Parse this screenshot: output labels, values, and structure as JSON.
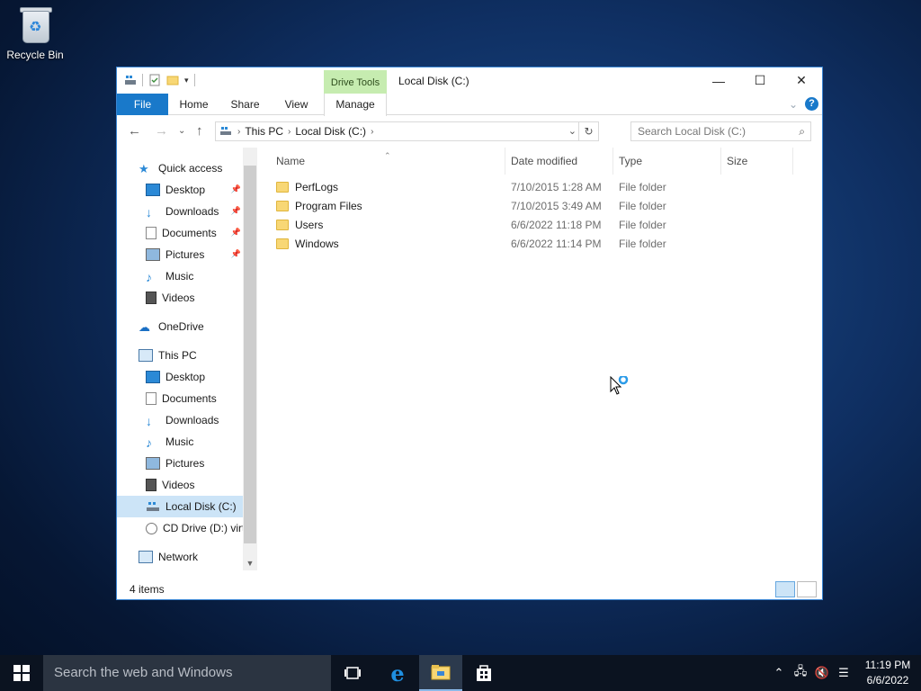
{
  "desktop": {
    "recycle_bin_label": "Recycle Bin"
  },
  "window": {
    "title": "Local Disk (C:)",
    "context_tab_group": "Drive Tools",
    "tabs": {
      "file": "File",
      "home": "Home",
      "share": "Share",
      "view": "View",
      "manage": "Manage"
    },
    "controls": {
      "minimize": "—",
      "maximize": "☐",
      "close": "✕"
    }
  },
  "navigation": {
    "breadcrumb": [
      "This PC",
      "Local Disk (C:)"
    ],
    "search_placeholder": "Search Local Disk (C:)"
  },
  "sidebar": {
    "quick_access": "Quick access",
    "quick_items": [
      "Desktop",
      "Downloads",
      "Documents",
      "Pictures",
      "Music",
      "Videos"
    ],
    "onedrive": "OneDrive",
    "this_pc": "This PC",
    "pc_items": [
      "Desktop",
      "Documents",
      "Downloads",
      "Music",
      "Pictures",
      "Videos",
      "Local Disk (C:)",
      "CD Drive (D:) virt"
    ],
    "network": "Network"
  },
  "columns": {
    "name": "Name",
    "date": "Date modified",
    "type": "Type",
    "size": "Size"
  },
  "files": [
    {
      "name": "PerfLogs",
      "date": "7/10/2015 1:28 AM",
      "type": "File folder"
    },
    {
      "name": "Program Files",
      "date": "7/10/2015 3:49 AM",
      "type": "File folder"
    },
    {
      "name": "Users",
      "date": "6/6/2022 11:18 PM",
      "type": "File folder"
    },
    {
      "name": "Windows",
      "date": "6/6/2022 11:14 PM",
      "type": "File folder"
    }
  ],
  "status": {
    "item_count": "4 items"
  },
  "taskbar": {
    "search_placeholder": "Search the web and Windows",
    "time": "11:19 PM",
    "date": "6/6/2022"
  },
  "colors": {
    "accent": "#1979ca",
    "drive_tools": "#c6ecb0",
    "selection": "#cce4f7",
    "folder": "#f8d775"
  }
}
